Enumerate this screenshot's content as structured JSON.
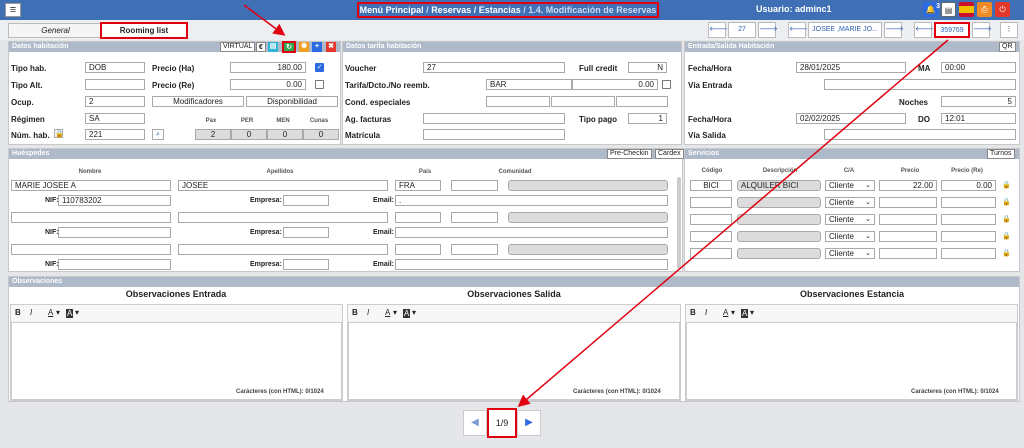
{
  "topbar": {
    "menu_icon": "hamburger-icon",
    "breadcrumb": {
      "item1": "Menú Principal",
      "item2": "Reservas / Estancias",
      "item3": "1.4. Modificación de Reservas"
    },
    "user": "Usuario: adminc1",
    "notif_count": "3",
    "icons": [
      "bell-icon",
      "document-icon",
      "flag-es-icon",
      "print-icon",
      "power-icon"
    ]
  },
  "tabs": {
    "general": "General",
    "rooming": "Rooming list"
  },
  "nav": {
    "room_num": "27",
    "guest_name": "JOSEE ,MARIE JO...",
    "booking_id": "359769"
  },
  "datos_hab": {
    "title": "Datos habitación",
    "virtual": "VIRTUAL",
    "tipo_hab_label": "Tipo hab.",
    "tipo_hab": "DOB",
    "tipo_alt_label": "Tipo Alt.",
    "ocup_label": "Ocup.",
    "ocup": "2",
    "regimen_label": "Régimen",
    "regimen": "SA",
    "num_hab_label": "Núm. hab.",
    "num_hab": "221",
    "precio_ha_label": "Precio (Ha)",
    "precio_ha": "180.00",
    "precio_re_label": "Precio (Re)",
    "precio_re": "0.00",
    "modificadores": "Modificadores",
    "disponibilidad": "Disponibilidad",
    "pax_headers": [
      "Pax",
      "PER",
      "MEN",
      "Cunas"
    ],
    "pax_values": [
      "2",
      "0",
      "0",
      "0"
    ]
  },
  "tarifa": {
    "title": "Datos tarifa habitación",
    "voucher_label": "Voucher",
    "voucher": "27",
    "full_credit_label": "Full credit",
    "full_credit": "N",
    "tarifa_label": "Tarifa/Dcto./No reemb.",
    "tarifa": "BAR",
    "dcto": "0.00",
    "cond_label": "Cond. especiales",
    "ag_label": "Ag. facturas",
    "tipo_pago_label": "Tipo pago",
    "tipo_pago": "1",
    "matricula_label": "Matrícula"
  },
  "entrada": {
    "title": "Entrada/Salida Habitación",
    "qr": "QR",
    "fecha_label": "Fecha/Hora",
    "fecha_entrada": "28/01/2025",
    "dia_entrada": "MA",
    "hora_entrada": "00:00",
    "via_entrada_label": "Vía Entrada",
    "noches_label": "Noches",
    "noches": "5",
    "fecha_salida": "02/02/2025",
    "dia_salida": "DO",
    "hora_salida": "12:01",
    "via_salida_label": "Vía Salida"
  },
  "huespedes": {
    "title": "Huéspedes",
    "prechecking": "Pre-Checkin",
    "cardex": "Cardex",
    "headers": {
      "nombre": "Nombre",
      "apellidos": "Apellidos",
      "pais": "País",
      "comunidad": "Comunidad"
    },
    "nif_label": "NIF:",
    "empresa_label": "Empresa:",
    "email_label": "Email:",
    "guest1": {
      "nombre": "MARIE JOSEE A",
      "apellidos": "JOSEE",
      "pais": "FRA",
      "nif": "110783202",
      "email": "."
    }
  },
  "servicios": {
    "title": "Servicios",
    "turnos": "Turnos",
    "headers": {
      "codigo": "Código",
      "descripcion": "Descripción",
      "ca": "C/A",
      "precio": "Precio",
      "precio_re": "Precio (Re)"
    },
    "row1": {
      "codigo": "BICI",
      "descripcion": "ALQUILER BICI",
      "ca": "Cliente",
      "precio": "22.00",
      "precio_re": "0.00"
    },
    "ca_default": "Cliente"
  },
  "observaciones": {
    "title": "Observaciones",
    "entrada": "Observaciones Entrada",
    "salida": "Observaciones Salida",
    "estancia": "Observaciones Estancia",
    "bold": "B",
    "italic": "I",
    "font_color": "A",
    "bg_color": "A",
    "counter": "Carácteres (con HTML): 0/1024"
  },
  "pagination": {
    "label": "1/9"
  },
  "colors": {
    "topbar": "#3f6fb5",
    "accent": "#2d5fb0",
    "annotation": "#e00010"
  }
}
